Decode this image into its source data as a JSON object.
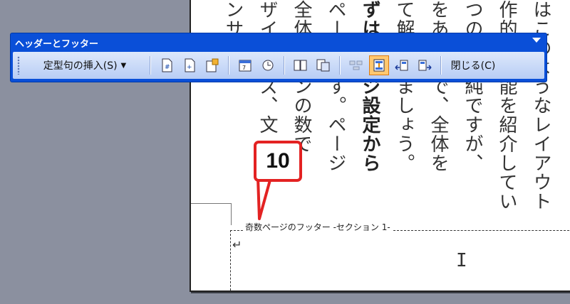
{
  "document": {
    "columns": [
      {
        "text": "はこのようなレイアウト",
        "bold": false
      },
      {
        "text": "作的な機能を紹介してい",
        "bold": false
      },
      {
        "text": "つのは単純ですが、",
        "bold": false
      },
      {
        "text": "をあるので、全体を",
        "bold": false
      },
      {
        "text": "て解説しましょう。",
        "bold": false
      },
      {
        "text": "ずはページ設定から",
        "bold": true
      },
      {
        "text": "ページです。ページ",
        "bold": false
      },
      {
        "text": "全体のインの数で",
        "bold": false
      },
      {
        "text": "ザインイズ、文",
        "bold": false
      },
      {
        "text": "ンサイズ",
        "bold": false
      }
    ],
    "footer_label": "奇数ページのフッター -セクション 1-",
    "paragraph_mark": "↵"
  },
  "callout": {
    "label": "10"
  },
  "toolbar": {
    "title": "ヘッダーとフッター",
    "insert_autotext_label": "定型句の挿入(S)",
    "close_label": "閉じる(C)",
    "buttons": [
      {
        "name": "page-number-icon",
        "group": 1
      },
      {
        "name": "page-count-icon",
        "group": 1
      },
      {
        "name": "format-page-number-icon",
        "group": 1
      },
      {
        "name": "date-icon",
        "group": 2
      },
      {
        "name": "time-icon",
        "group": 2
      },
      {
        "name": "page-setup-icon",
        "group": 3
      },
      {
        "name": "show-document-text-icon",
        "group": 3
      },
      {
        "name": "link-to-previous-icon",
        "group": 4
      },
      {
        "name": "switch-header-footer-icon",
        "group": 4,
        "active": true
      },
      {
        "name": "show-previous-icon",
        "group": 4
      },
      {
        "name": "show-next-icon",
        "group": 4
      }
    ]
  },
  "colors": {
    "toolbar_blue": "#0a4fd8",
    "callout_red": "#e32222",
    "desktop_gray": "#8b909f",
    "active_button": "#ffc870"
  }
}
